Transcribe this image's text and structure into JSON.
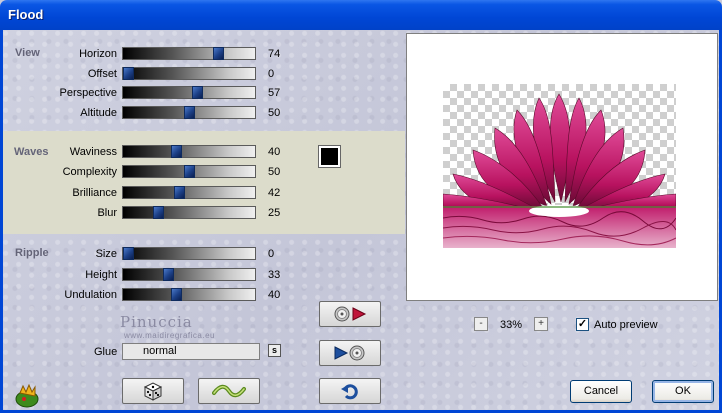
{
  "window": {
    "title": "Flood"
  },
  "groups": {
    "view": "View",
    "waves": "Waves",
    "ripple": "Ripple"
  },
  "sliders": {
    "horizon": {
      "label": "Horizon",
      "value": "74",
      "fraction": 0.74
    },
    "offset": {
      "label": "Offset",
      "value": "0",
      "fraction": 0.0
    },
    "perspective": {
      "label": "Perspective",
      "value": "57",
      "fraction": 0.57
    },
    "altitude": {
      "label": "Altitude",
      "value": "50",
      "fraction": 0.5
    },
    "waviness": {
      "label": "Waviness",
      "value": "40",
      "fraction": 0.4
    },
    "complexity": {
      "label": "Complexity",
      "value": "50",
      "fraction": 0.5
    },
    "brilliance": {
      "label": "Brilliance",
      "value": "42",
      "fraction": 0.42
    },
    "blur": {
      "label": "Blur",
      "value": "25",
      "fraction": 0.25
    },
    "size": {
      "label": "Size",
      "value": "0",
      "fraction": 0.0
    },
    "height": {
      "label": "Height",
      "value": "33",
      "fraction": 0.33
    },
    "undulation": {
      "label": "Undulation",
      "value": "40",
      "fraction": 0.4
    }
  },
  "color": {
    "waves_color": "#000000"
  },
  "glue": {
    "label": "Glue",
    "value": "normal",
    "s_button": "s"
  },
  "watermark": {
    "name": "Pinuccia",
    "site": "www.maidiregrafica.eu"
  },
  "zoom": {
    "minus": "-",
    "level": "33%",
    "plus": "+"
  },
  "auto_preview": {
    "label": "Auto preview",
    "checked": true,
    "check_mark": "✓"
  },
  "buttons": {
    "cancel": "Cancel",
    "ok": "OK"
  },
  "icons": {
    "app": "filters-unlimited-icon",
    "dice": "dice-icon",
    "wave": "wave-icon",
    "reset": "undo-icon",
    "save_preset": "save-preset-icon",
    "load_preset": "load-preset-icon"
  }
}
